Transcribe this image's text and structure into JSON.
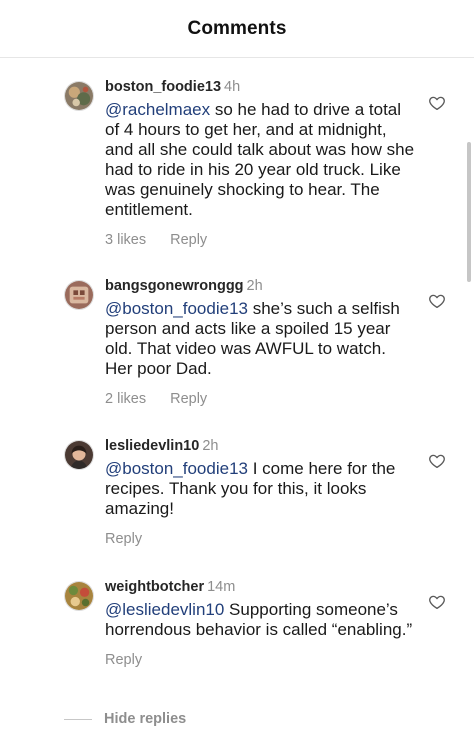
{
  "header": {
    "title": "Comments"
  },
  "comments": [
    {
      "username": "boston_foodie13",
      "time": "4h",
      "mention": "@rachelmaex",
      "text": " so he had to drive a total of 4 hours to get her, and at midnight, and all she could talk about was how she had to ride in his 20 year old truck. Like was genuinely shocking to hear. The entitlement.",
      "likes": "3 likes",
      "reply": "Reply"
    },
    {
      "username": "bangsgonewronggg",
      "time": "2h",
      "mention": "@boston_foodie13",
      "text": " she’s such a selfish person and acts like a spoiled 15 year old. That video was AWFUL to watch. Her poor Dad.",
      "likes": "2 likes",
      "reply": "Reply"
    },
    {
      "username": "lesliedevlin10",
      "time": "2h",
      "mention": "@boston_foodie13",
      "text": " I come here for the recipes. Thank you for this, it looks amazing!",
      "likes": "",
      "reply": "Reply"
    },
    {
      "username": "weightbotcher",
      "time": "14m",
      "mention": "@lesliedevlin10",
      "text": " Supporting someone’s horrendous behavior is called “enabling.”",
      "likes": "",
      "reply": "Reply"
    }
  ],
  "footer": {
    "hide_replies": "Hide replies"
  },
  "colors": {
    "mention": "#223f7a",
    "muted": "#8e8e8e",
    "text": "#262626"
  },
  "icons": {
    "like": "heart-outline-icon"
  }
}
